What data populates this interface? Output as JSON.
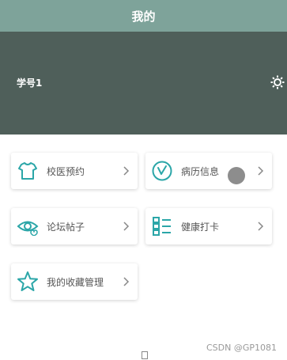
{
  "header": {
    "title": "我的"
  },
  "profile": {
    "student_id": "学号1",
    "settings_icon": "gear-icon"
  },
  "menu": [
    {
      "label": "校医预约",
      "icon": "tshirt-icon"
    },
    {
      "label": "病历信息",
      "icon": "clock-check-icon"
    },
    {
      "label": "论坛帖子",
      "icon": "eye-heart-icon"
    },
    {
      "label": "健康打卡",
      "icon": "checklist-icon"
    },
    {
      "label": "我的收藏管理",
      "icon": "star-icon"
    }
  ],
  "colors": {
    "header_bg": "#7ea39a",
    "profile_bg": "#4f5f5a",
    "icon_teal": "#2ba6a8"
  },
  "watermark": "CSDN @GP1081"
}
